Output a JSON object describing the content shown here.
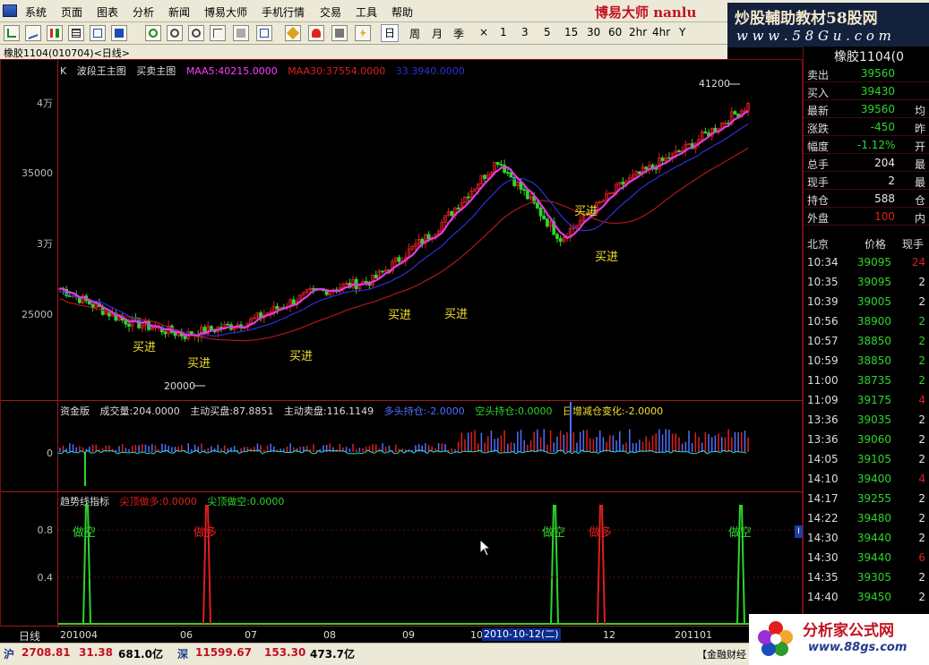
{
  "menu": {
    "items": [
      "系统",
      "页面",
      "图表",
      "分析",
      "新闻",
      "博易大师",
      "手机行情",
      "交易",
      "工具",
      "帮助"
    ],
    "brand": "博易大师 nanlu"
  },
  "watermark": {
    "line1": "炒股輔助教材58股网",
    "line2": "w w w . 5 8 G u . c o m"
  },
  "toolbar": {
    "periods": [
      "日",
      "周",
      "月",
      "季",
      "×",
      "1",
      "3",
      "5",
      "15",
      "30",
      "60",
      "2hr",
      "4hr",
      "Y"
    ]
  },
  "window": {
    "title": "橡胶1104(010704)<日线>"
  },
  "main_panel": {
    "legend": [
      {
        "text": "K",
        "color": "#dddddd"
      },
      {
        "text": "波段王主图",
        "color": "#dddddd"
      },
      {
        "text": "买卖主图",
        "color": "#dddddd"
      },
      {
        "text": "MAA5:40215.0000",
        "color": "#ff3cff"
      },
      {
        "text": "MAA30:37554.0000",
        "color": "#e11e1e"
      },
      {
        "text": "33.3940.0000",
        "color": "#2f2fd6"
      }
    ],
    "high_label": "41200",
    "low_label": "20000",
    "buy_label": "买进"
  },
  "volume_panel": {
    "legend": [
      {
        "text": "资金版",
        "color": "#dddddd"
      },
      {
        "text": "成交量:204.0000",
        "color": "#dddddd"
      },
      {
        "text": "主动买盘:87.8851",
        "color": "#dddddd"
      },
      {
        "text": "主动卖盘:116.1149",
        "color": "#dddddd"
      },
      {
        "text": "多头持仓:-2.0000",
        "color": "#4f6fff"
      },
      {
        "text": "空头持仓:0.0000",
        "color": "#2dd52d"
      },
      {
        "text": "日增减仓变化:-2.0000",
        "color": "#f2e030"
      }
    ]
  },
  "trend_panel": {
    "legend": [
      {
        "text": "趋势线指标",
        "color": "#dddddd"
      },
      {
        "text": "尖顶做多:0.0000",
        "color": "#e11e1e"
      },
      {
        "text": "尖顶做空:0.0000",
        "color": "#2dd52d"
      }
    ],
    "short_label": "做空",
    "long_label": "做多"
  },
  "x_axis": {
    "period_tag": "日线",
    "labels": [
      "201004",
      "06",
      "07",
      "08",
      "09",
      "10",
      "12",
      "201101"
    ],
    "cursor_date": "2010-10-12(二)"
  },
  "quote": {
    "symbol": "橡胶1104(0",
    "rows": [
      {
        "label": "卖出",
        "value": "39560",
        "extra": "",
        "color": "#2dd52d"
      },
      {
        "label": "买入",
        "value": "39430",
        "extra": "",
        "color": "#2dd52d"
      },
      {
        "label": "最新",
        "value": "39560",
        "extra": "均",
        "color": "#2dd52d"
      },
      {
        "label": "涨跌",
        "value": "-450",
        "extra": "昨",
        "color": "#2dd52d"
      },
      {
        "label": "幅度",
        "value": "-1.12%",
        "extra": "开",
        "color": "#2dd52d"
      },
      {
        "label": "总手",
        "value": "204",
        "extra": "最",
        "color": "#e8e8e8"
      },
      {
        "label": "现手",
        "value": "2",
        "extra": "最",
        "color": "#e8e8e8"
      },
      {
        "label": "持仓",
        "value": "588",
        "extra": "仓",
        "color": "#e8e8e8"
      },
      {
        "label": "外盘",
        "value": "100",
        "extra": "内",
        "color": "#e11e1e"
      }
    ]
  },
  "ticks": {
    "headers": [
      "北京",
      "价格",
      "现手"
    ],
    "rows": [
      {
        "time": "10:34",
        "price": "39095",
        "vol": "24",
        "vc": "#e11e1e"
      },
      {
        "time": "10:35",
        "price": "39095",
        "vol": "2",
        "vc": "#e8e8e8"
      },
      {
        "time": "10:39",
        "price": "39005",
        "vol": "2",
        "vc": "#e8e8e8"
      },
      {
        "time": "10:56",
        "price": "38900",
        "vol": "2",
        "vc": "#2dd52d"
      },
      {
        "time": "10:57",
        "price": "38850",
        "vol": "2",
        "vc": "#2dd52d"
      },
      {
        "time": "10:59",
        "price": "38850",
        "vol": "2",
        "vc": "#2dd52d"
      },
      {
        "time": "11:00",
        "price": "38735",
        "vol": "2",
        "vc": "#2dd52d"
      },
      {
        "time": "11:09",
        "price": "39175",
        "vol": "4",
        "vc": "#e11e1e"
      },
      {
        "time": "13:36",
        "price": "39035",
        "vol": "2",
        "vc": "#e8e8e8"
      },
      {
        "time": "13:36",
        "price": "39060",
        "vol": "2",
        "vc": "#e8e8e8"
      },
      {
        "time": "14:05",
        "price": "39105",
        "vol": "2",
        "vc": "#e8e8e8"
      },
      {
        "time": "14:10",
        "price": "39400",
        "vol": "4",
        "vc": "#e11e1e"
      },
      {
        "time": "14:17",
        "price": "39255",
        "vol": "2",
        "vc": "#e8e8e8"
      },
      {
        "time": "14:22",
        "price": "39480",
        "vol": "2",
        "vc": "#e8e8e8"
      },
      {
        "time": "14:30",
        "price": "39440",
        "vol": "2",
        "vc": "#e8e8e8"
      },
      {
        "time": "14:30",
        "price": "39440",
        "vol": "6",
        "vc": "#e11e1e"
      },
      {
        "time": "14:35",
        "price": "39305",
        "vol": "2",
        "vc": "#e8e8e8"
      },
      {
        "time": "14:40",
        "price": "39450",
        "vol": "2",
        "vc": "#e8e8e8"
      }
    ]
  },
  "status": {
    "sh_label": "沪",
    "sh_index": "2708.81",
    "sh_change": "31.38",
    "sh_amount": "681.0亿",
    "sz_label": "深",
    "sz_index": "11599.67",
    "sz_change": "153.30",
    "sz_amount": "473.7亿",
    "server": "【金融财经"
  },
  "logo2": {
    "line1": "分析家公式网",
    "line2": "www.88gs.com"
  },
  "chart_data": [
    {
      "type": "candlestick",
      "title": "橡胶1104(010704)<日线>",
      "y_ticks": [
        "4万",
        "35000",
        "3万",
        "25000"
      ],
      "annotations": [
        "41200",
        "20000",
        "买进"
      ],
      "close_path": [
        {
          "x": "201004",
          "y": 25500
        },
        {
          "x": "05",
          "y": 22800
        },
        {
          "x": "06",
          "y": 21500
        },
        {
          "x": "07",
          "y": 22600
        },
        {
          "x": "08",
          "y": 25100
        },
        {
          "x": "09",
          "y": 26200
        },
        {
          "x": "10",
          "y": 30500
        },
        {
          "x": "10-12",
          "y": 36500
        },
        {
          "x": "11",
          "y": 29800
        },
        {
          "x": "12",
          "y": 34500
        },
        {
          "x": "201101",
          "y": 37500
        },
        {
          "x": "201102",
          "y": 41200
        }
      ],
      "series": [
        {
          "name": "MAA5"
        },
        {
          "name": "MAA30"
        }
      ]
    },
    {
      "type": "bar",
      "title": "资金版",
      "y_ticks": [
        "0"
      ],
      "series": [
        {
          "name": "成交量"
        },
        {
          "name": "多头持仓"
        },
        {
          "name": "空头持仓"
        }
      ]
    },
    {
      "type": "line",
      "title": "趋势线指标",
      "y_ticks": [
        "0.8",
        "0.4"
      ],
      "signals": [
        {
          "x": "201004",
          "name": "做空"
        },
        {
          "x": "06",
          "name": "做多"
        },
        {
          "x": "10-12",
          "name": "做空"
        },
        {
          "x": "11",
          "name": "做多"
        },
        {
          "x": "201101",
          "name": "做空"
        }
      ]
    }
  ]
}
